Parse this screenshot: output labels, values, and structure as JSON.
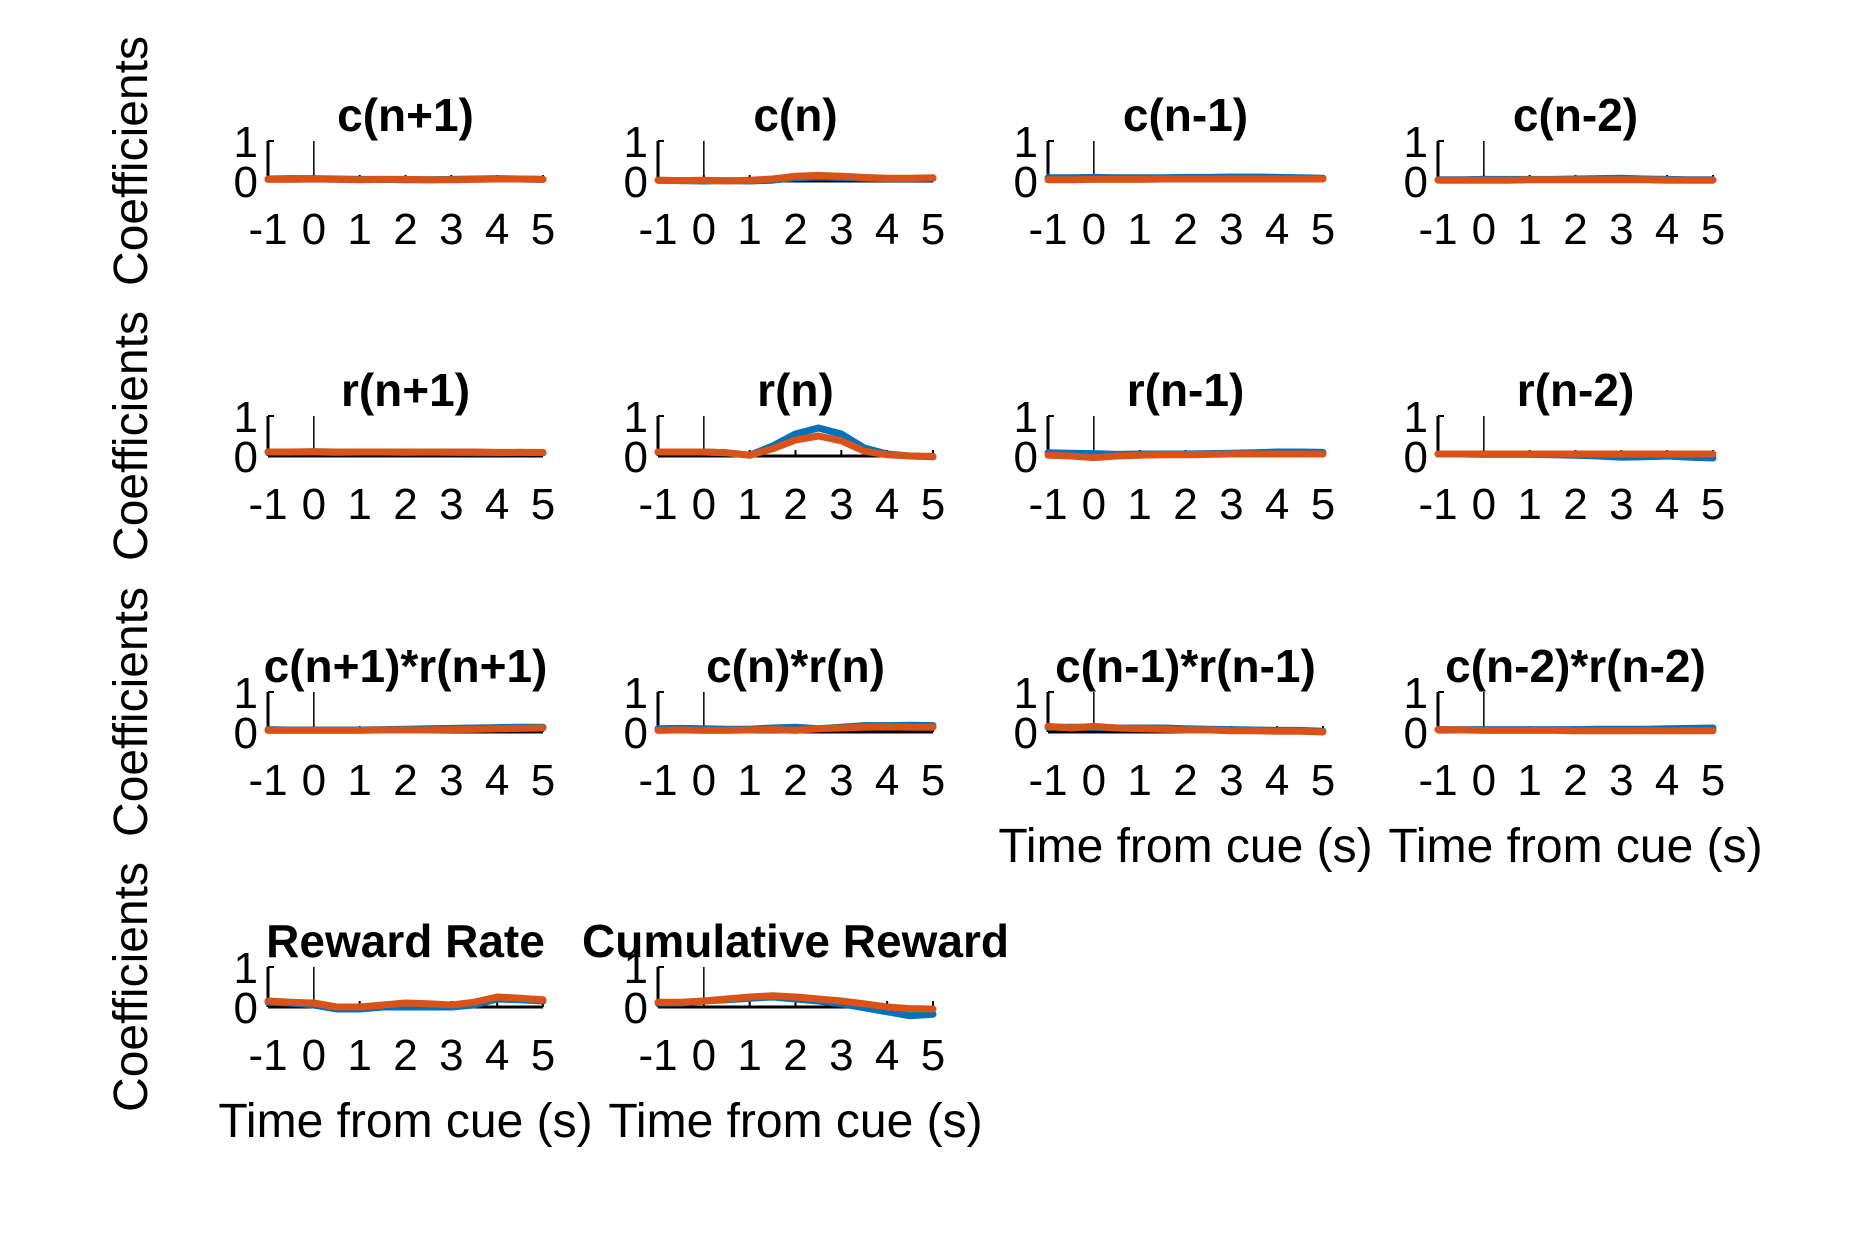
{
  "figure": {
    "ylabel": "Coefficients",
    "xlabel": "Time from cue (s)"
  },
  "chart_data": [
    {
      "type": "line",
      "title": "c(n+1)",
      "xlim": [
        -1,
        5
      ],
      "ylim": [
        0,
        1
      ],
      "xticks": [
        "-1",
        "0",
        "1",
        "2",
        "3",
        "4",
        "5"
      ],
      "yticks": [
        "0",
        "1"
      ],
      "xlabel": "",
      "ylabel": "Coefficients",
      "x": [
        -1,
        -0.5,
        0,
        0.5,
        1,
        1.5,
        2,
        2.5,
        3,
        3.5,
        4,
        4.5,
        5
      ],
      "series": [
        {
          "color": "#0072BD",
          "values": [
            0.05,
            0.06,
            0.06,
            0.05,
            0.04,
            0.04,
            0.03,
            0.03,
            0.04,
            0.05,
            0.06,
            0.05,
            0.04
          ]
        },
        {
          "color": "#D95319",
          "values": [
            0.04,
            0.04,
            0.05,
            0.04,
            0.03,
            0.04,
            0.04,
            0.03,
            0.03,
            0.04,
            0.05,
            0.05,
            0.04
          ]
        }
      ]
    },
    {
      "type": "line",
      "title": "c(n)",
      "xlim": [
        -1,
        5
      ],
      "ylim": [
        0,
        1
      ],
      "xticks": [
        "-1",
        "0",
        "1",
        "2",
        "3",
        "4",
        "5"
      ],
      "yticks": [
        "0",
        "1"
      ],
      "xlabel": "",
      "ylabel": "",
      "x": [
        -1,
        -0.5,
        0,
        0.5,
        1,
        1.5,
        2,
        2.5,
        3,
        3.5,
        4,
        4.5,
        5
      ],
      "series": [
        {
          "color": "#0072BD",
          "values": [
            0.02,
            0.01,
            0.0,
            0.01,
            0.0,
            0.02,
            0.08,
            0.1,
            0.09,
            0.07,
            0.06,
            0.06,
            0.07
          ]
        },
        {
          "color": "#D95319",
          "values": [
            0.02,
            0.01,
            0.02,
            0.0,
            0.02,
            0.05,
            0.12,
            0.14,
            0.12,
            0.09,
            0.07,
            0.07,
            0.08
          ]
        }
      ]
    },
    {
      "type": "line",
      "title": "c(n-1)",
      "xlim": [
        -1,
        5
      ],
      "ylim": [
        0,
        1
      ],
      "xticks": [
        "-1",
        "0",
        "1",
        "2",
        "3",
        "4",
        "5"
      ],
      "yticks": [
        "0",
        "1"
      ],
      "xlabel": "",
      "ylabel": "",
      "x": [
        -1,
        -0.5,
        0,
        0.5,
        1,
        1.5,
        2,
        2.5,
        3,
        3.5,
        4,
        4.5,
        5
      ],
      "series": [
        {
          "color": "#0072BD",
          "values": [
            0.08,
            0.08,
            0.09,
            0.08,
            0.08,
            0.08,
            0.09,
            0.09,
            0.1,
            0.1,
            0.09,
            0.08,
            0.07
          ]
        },
        {
          "color": "#D95319",
          "values": [
            0.03,
            0.03,
            0.04,
            0.04,
            0.04,
            0.05,
            0.05,
            0.05,
            0.05,
            0.05,
            0.05,
            0.05,
            0.05
          ]
        }
      ]
    },
    {
      "type": "line",
      "title": "c(n-2)",
      "xlim": [
        -1,
        5
      ],
      "ylim": [
        0,
        1
      ],
      "xticks": [
        "-1",
        "0",
        "1",
        "2",
        "3",
        "4",
        "5"
      ],
      "yticks": [
        "0",
        "1"
      ],
      "xlabel": "",
      "ylabel": "",
      "x": [
        -1,
        -0.5,
        0,
        0.5,
        1,
        1.5,
        2,
        2.5,
        3,
        3.5,
        4,
        4.5,
        5
      ],
      "series": [
        {
          "color": "#0072BD",
          "values": [
            0.03,
            0.03,
            0.04,
            0.04,
            0.04,
            0.04,
            0.05,
            0.06,
            0.07,
            0.05,
            0.04,
            0.03,
            0.03
          ]
        },
        {
          "color": "#D95319",
          "values": [
            0.02,
            0.02,
            0.02,
            0.02,
            0.03,
            0.03,
            0.03,
            0.03,
            0.03,
            0.03,
            0.02,
            0.02,
            0.02
          ]
        }
      ]
    },
    {
      "type": "line",
      "title": "r(n+1)",
      "xlim": [
        -1,
        5
      ],
      "ylim": [
        0,
        1
      ],
      "xticks": [
        "-1",
        "0",
        "1",
        "2",
        "3",
        "4",
        "5"
      ],
      "yticks": [
        "0",
        "1"
      ],
      "xlabel": "",
      "ylabel": "Coefficients",
      "x": [
        -1,
        -0.5,
        0,
        0.5,
        1,
        1.5,
        2,
        2.5,
        3,
        3.5,
        4,
        4.5,
        5
      ],
      "series": [
        {
          "color": "#0072BD",
          "values": [
            0.1,
            0.1,
            0.1,
            0.09,
            0.1,
            0.1,
            0.09,
            0.1,
            0.09,
            0.08,
            0.08,
            0.09,
            0.08
          ]
        },
        {
          "color": "#D95319",
          "values": [
            0.1,
            0.1,
            0.11,
            0.1,
            0.1,
            0.1,
            0.1,
            0.1,
            0.1,
            0.1,
            0.09,
            0.09,
            0.09
          ]
        }
      ]
    },
    {
      "type": "line",
      "title": "r(n)",
      "xlim": [
        -1,
        5
      ],
      "ylim": [
        0,
        1
      ],
      "xticks": [
        "-1",
        "0",
        "1",
        "2",
        "3",
        "4",
        "5"
      ],
      "yticks": [
        "0",
        "1"
      ],
      "xlabel": "",
      "ylabel": "",
      "x": [
        -1,
        -0.5,
        0,
        0.5,
        1,
        1.5,
        2,
        2.5,
        3,
        3.5,
        4,
        4.5,
        5
      ],
      "series": [
        {
          "color": "#0072BD",
          "values": [
            0.1,
            0.1,
            0.1,
            0.08,
            0.02,
            0.25,
            0.55,
            0.7,
            0.55,
            0.2,
            0.05,
            0.0,
            -0.02
          ]
        },
        {
          "color": "#D95319",
          "values": [
            0.1,
            0.1,
            0.1,
            0.08,
            0.02,
            0.18,
            0.4,
            0.5,
            0.38,
            0.12,
            0.03,
            0.0,
            -0.01
          ]
        }
      ]
    },
    {
      "type": "line",
      "title": "r(n-1)",
      "xlim": [
        -1,
        5
      ],
      "ylim": [
        0,
        1
      ],
      "xticks": [
        "-1",
        "0",
        "1",
        "2",
        "3",
        "4",
        "5"
      ],
      "yticks": [
        "0",
        "1"
      ],
      "xlabel": "",
      "ylabel": "",
      "x": [
        -1,
        -0.5,
        0,
        0.5,
        1,
        1.5,
        2,
        2.5,
        3,
        3.5,
        4,
        4.5,
        5
      ],
      "series": [
        {
          "color": "#0072BD",
          "values": [
            0.08,
            0.07,
            0.06,
            0.04,
            0.05,
            0.05,
            0.05,
            0.06,
            0.07,
            0.08,
            0.1,
            0.1,
            0.09
          ]
        },
        {
          "color": "#D95319",
          "values": [
            0.02,
            0.0,
            -0.04,
            0.0,
            0.02,
            0.03,
            0.03,
            0.04,
            0.05,
            0.05,
            0.05,
            0.05,
            0.05
          ]
        }
      ]
    },
    {
      "type": "line",
      "title": "r(n-2)",
      "xlim": [
        -1,
        5
      ],
      "ylim": [
        0,
        1
      ],
      "xticks": [
        "-1",
        "0",
        "1",
        "2",
        "3",
        "4",
        "5"
      ],
      "yticks": [
        "0",
        "1"
      ],
      "xlabel": "",
      "ylabel": "",
      "x": [
        -1,
        -0.5,
        0,
        0.5,
        1,
        1.5,
        2,
        2.5,
        3,
        3.5,
        4,
        4.5,
        5
      ],
      "series": [
        {
          "color": "#0072BD",
          "values": [
            0.05,
            0.05,
            0.04,
            0.04,
            0.04,
            0.03,
            0.02,
            0.0,
            -0.03,
            -0.02,
            0.0,
            -0.03,
            -0.05
          ]
        },
        {
          "color": "#D95319",
          "values": [
            0.05,
            0.05,
            0.05,
            0.05,
            0.05,
            0.05,
            0.05,
            0.05,
            0.05,
            0.05,
            0.05,
            0.05,
            0.05
          ]
        }
      ]
    },
    {
      "type": "line",
      "title": "c(n+1)*r(n+1)",
      "xlim": [
        -1,
        5
      ],
      "ylim": [
        0,
        1
      ],
      "xticks": [
        "-1",
        "0",
        "1",
        "2",
        "3",
        "4",
        "5"
      ],
      "yticks": [
        "0",
        "1"
      ],
      "xlabel": "",
      "ylabel": "Coefficients",
      "x": [
        -1,
        -0.5,
        0,
        0.5,
        1,
        1.5,
        2,
        2.5,
        3,
        3.5,
        4,
        4.5,
        5
      ],
      "series": [
        {
          "color": "#0072BD",
          "values": [
            0.06,
            0.05,
            0.05,
            0.05,
            0.05,
            0.06,
            0.07,
            0.08,
            0.09,
            0.1,
            0.11,
            0.12,
            0.12
          ]
        },
        {
          "color": "#D95319",
          "values": [
            0.04,
            0.04,
            0.04,
            0.04,
            0.04,
            0.05,
            0.05,
            0.05,
            0.06,
            0.07,
            0.08,
            0.09,
            0.1
          ]
        }
      ]
    },
    {
      "type": "line",
      "title": "c(n)*r(n)",
      "xlim": [
        -1,
        5
      ],
      "ylim": [
        0,
        1
      ],
      "xticks": [
        "-1",
        "0",
        "1",
        "2",
        "3",
        "4",
        "5"
      ],
      "yticks": [
        "0",
        "1"
      ],
      "xlabel": "",
      "ylabel": "",
      "x": [
        -1,
        -0.5,
        0,
        0.5,
        1,
        1.5,
        2,
        2.5,
        3,
        3.5,
        4,
        4.5,
        5
      ],
      "series": [
        {
          "color": "#0072BD",
          "values": [
            0.08,
            0.09,
            0.08,
            0.07,
            0.07,
            0.1,
            0.12,
            0.08,
            0.12,
            0.16,
            0.16,
            0.17,
            0.16
          ]
        },
        {
          "color": "#D95319",
          "values": [
            0.04,
            0.05,
            0.04,
            0.04,
            0.05,
            0.06,
            0.04,
            0.08,
            0.1,
            0.12,
            0.13,
            0.12,
            0.12
          ]
        }
      ]
    },
    {
      "type": "line",
      "title": "c(n-1)*r(n-1)",
      "xlim": [
        -1,
        5
      ],
      "ylim": [
        0,
        1
      ],
      "xticks": [
        "-1",
        "0",
        "1",
        "2",
        "3",
        "4",
        "5"
      ],
      "yticks": [
        "0",
        "1"
      ],
      "xlabel": "Time from cue (s)",
      "ylabel": "",
      "x": [
        -1,
        -0.5,
        0,
        0.5,
        1,
        1.5,
        2,
        2.5,
        3,
        3.5,
        4,
        4.5,
        5
      ],
      "series": [
        {
          "color": "#0072BD",
          "values": [
            0.12,
            0.12,
            0.12,
            0.1,
            0.1,
            0.1,
            0.08,
            0.07,
            0.06,
            0.05,
            0.04,
            0.04,
            0.02
          ]
        },
        {
          "color": "#D95319",
          "values": [
            0.14,
            0.1,
            0.14,
            0.1,
            0.08,
            0.07,
            0.05,
            0.05,
            0.03,
            0.03,
            0.02,
            0.02,
            0.0
          ]
        }
      ]
    },
    {
      "type": "line",
      "title": "c(n-2)*r(n-2)",
      "xlim": [
        -1,
        5
      ],
      "ylim": [
        0,
        1
      ],
      "xticks": [
        "-1",
        "0",
        "1",
        "2",
        "3",
        "4",
        "5"
      ],
      "yticks": [
        "0",
        "1"
      ],
      "xlabel": "Time from cue (s)",
      "ylabel": "",
      "x": [
        -1,
        -0.5,
        0,
        0.5,
        1,
        1.5,
        2,
        2.5,
        3,
        3.5,
        4,
        4.5,
        5
      ],
      "series": [
        {
          "color": "#0072BD",
          "values": [
            0.06,
            0.06,
            0.06,
            0.06,
            0.06,
            0.06,
            0.06,
            0.07,
            0.07,
            0.07,
            0.08,
            0.09,
            0.1
          ]
        },
        {
          "color": "#D95319",
          "values": [
            0.06,
            0.05,
            0.04,
            0.04,
            0.04,
            0.04,
            0.03,
            0.03,
            0.03,
            0.03,
            0.03,
            0.03,
            0.03
          ]
        }
      ]
    },
    {
      "type": "line",
      "title": "Reward Rate",
      "xlim": [
        -1,
        5
      ],
      "ylim": [
        0,
        1
      ],
      "xticks": [
        "-1",
        "0",
        "1",
        "2",
        "3",
        "4",
        "5"
      ],
      "yticks": [
        "0",
        "1"
      ],
      "xlabel": "Time from cue (s)",
      "ylabel": "Coefficients",
      "x": [
        -1,
        -0.5,
        0,
        0.5,
        1,
        1.5,
        2,
        2.5,
        3,
        3.5,
        4,
        4.5,
        5
      ],
      "series": [
        {
          "color": "#0072BD",
          "values": [
            0.12,
            0.1,
            0.05,
            -0.05,
            -0.05,
            0.0,
            0.0,
            0.0,
            0.0,
            0.05,
            0.2,
            0.18,
            0.15
          ]
        },
        {
          "color": "#D95319",
          "values": [
            0.15,
            0.12,
            0.1,
            0.0,
            0.0,
            0.05,
            0.1,
            0.08,
            0.05,
            0.12,
            0.25,
            0.22,
            0.18
          ]
        }
      ]
    },
    {
      "type": "line",
      "title": "Cumulative Reward",
      "xlim": [
        -1,
        5
      ],
      "ylim": [
        0,
        1
      ],
      "xticks": [
        "-1",
        "0",
        "1",
        "2",
        "3",
        "4",
        "5"
      ],
      "yticks": [
        "0",
        "1"
      ],
      "xlabel": "Time from cue (s)",
      "ylabel": "",
      "x": [
        -1,
        -0.5,
        0,
        0.5,
        1,
        1.5,
        2,
        2.5,
        3,
        3.5,
        4,
        4.5,
        5
      ],
      "series": [
        {
          "color": "#0072BD",
          "values": [
            0.1,
            0.1,
            0.15,
            0.18,
            0.22,
            0.25,
            0.2,
            0.15,
            0.08,
            -0.02,
            -0.12,
            -0.22,
            -0.18
          ]
        },
        {
          "color": "#D95319",
          "values": [
            0.12,
            0.12,
            0.15,
            0.2,
            0.25,
            0.28,
            0.25,
            0.2,
            0.15,
            0.08,
            0.0,
            -0.04,
            -0.05
          ]
        }
      ]
    }
  ]
}
